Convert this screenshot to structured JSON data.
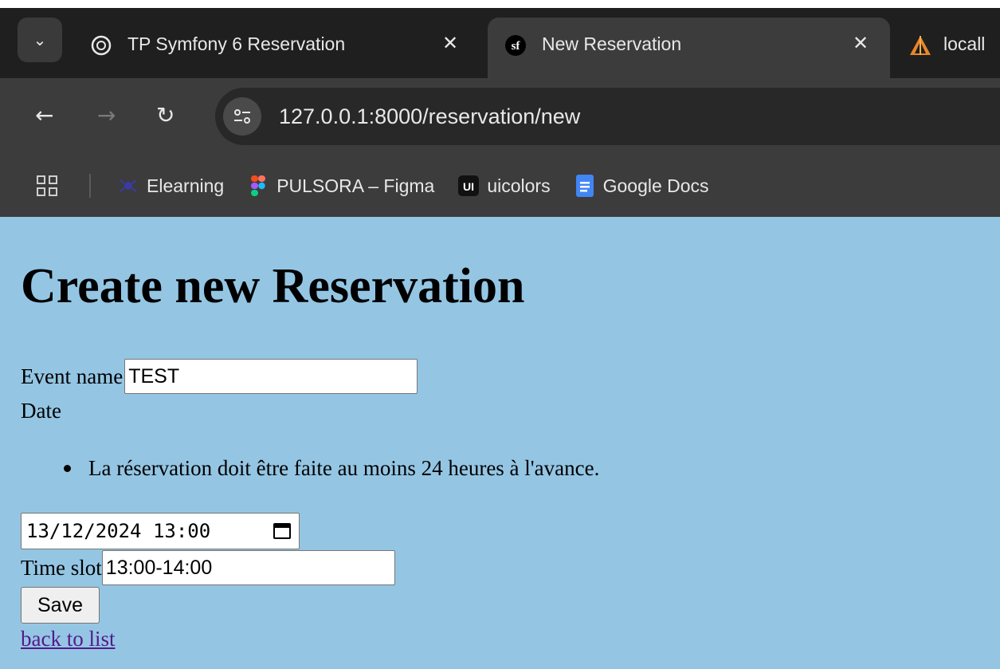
{
  "browser": {
    "tabs": [
      {
        "title": "TP Symfony 6 Reservation",
        "icon": "chatgpt-icon",
        "active": false
      },
      {
        "title": "New Reservation",
        "icon": "symfony-icon",
        "active": true
      },
      {
        "title": "locall",
        "icon": "xampp-icon",
        "active": false
      }
    ],
    "url": "127.0.0.1:8000/reservation/new",
    "bookmarks": [
      {
        "label": "Elearning",
        "icon": "elearning-icon"
      },
      {
        "label": "PULSORA – Figma",
        "icon": "figma-icon"
      },
      {
        "label": "uicolors",
        "icon": "uicolors-icon"
      },
      {
        "label": "Google Docs",
        "icon": "google-docs-icon"
      }
    ],
    "colors": {
      "chrome_dark": "#1f1f1f",
      "chrome_toolbar": "#3c3c3c",
      "page_bg": "#94c6e4"
    }
  },
  "page": {
    "title": "Create new Reservation",
    "form": {
      "event_name_label": "Event name",
      "event_name_value": "TEST",
      "date_label": "Date",
      "date_error": "La réservation doit être faite au moins 24 heures à l'avance.",
      "date_value": "13/12/2024 13:00",
      "time_slot_label": "Time slot",
      "time_slot_value": "13:00-14:00",
      "save_label": "Save"
    },
    "back_link": "back to list"
  }
}
